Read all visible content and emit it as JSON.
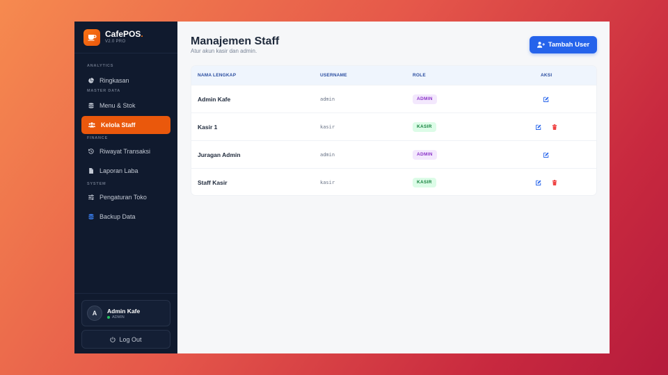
{
  "brand": {
    "name": "CafePOS",
    "dot": ".",
    "version": "V2.0 PRO"
  },
  "sidebar": {
    "sections": [
      {
        "label": "ANALYTICS",
        "items": [
          {
            "label": "Ringkasan",
            "icon": "pie-chart-icon"
          }
        ]
      },
      {
        "label": "MASTER DATA",
        "items": [
          {
            "label": "Menu & Stok",
            "icon": "database-icon"
          },
          {
            "label": "Kelola Staff",
            "icon": "users-icon",
            "active": true
          }
        ]
      },
      {
        "label": "FINANCE",
        "items": [
          {
            "label": "Riwayat Transaksi",
            "icon": "history-icon"
          },
          {
            "label": "Laporan Laba",
            "icon": "file-icon"
          }
        ]
      },
      {
        "label": "SYSTEM",
        "items": [
          {
            "label": "Pengaturan Toko",
            "icon": "sliders-icon"
          },
          {
            "label": "Backup Data",
            "icon": "database-blue-icon"
          }
        ]
      }
    ],
    "profile": {
      "initial": "A",
      "name": "Admin Kafe",
      "role": "ADMIN"
    },
    "logout_label": "Log Out"
  },
  "main": {
    "title": "Manajemen Staff",
    "subtitle": "Atur akun kasir dan admin.",
    "add_button": "Tambah User",
    "table": {
      "headers": {
        "name": "NAMA LENGKAP",
        "username": "USERNAME",
        "role": "ROLE",
        "actions": "AKSI"
      },
      "rows": [
        {
          "name": "Admin Kafe",
          "username": "admin",
          "role": "ADMIN",
          "deletable": false
        },
        {
          "name": "Kasir 1",
          "username": "kasir",
          "role": "KASIR",
          "deletable": true
        },
        {
          "name": "Juragan Admin",
          "username": "admin",
          "role": "ADMIN",
          "deletable": false
        },
        {
          "name": "Staff Kasir",
          "username": "kasir",
          "role": "KASIR",
          "deletable": true
        }
      ]
    }
  },
  "colors": {
    "accent": "#ea580c",
    "primary": "#2563eb",
    "sidebar_bg": "#101a2e",
    "delete": "#ef4444",
    "edit": "#2563eb"
  }
}
